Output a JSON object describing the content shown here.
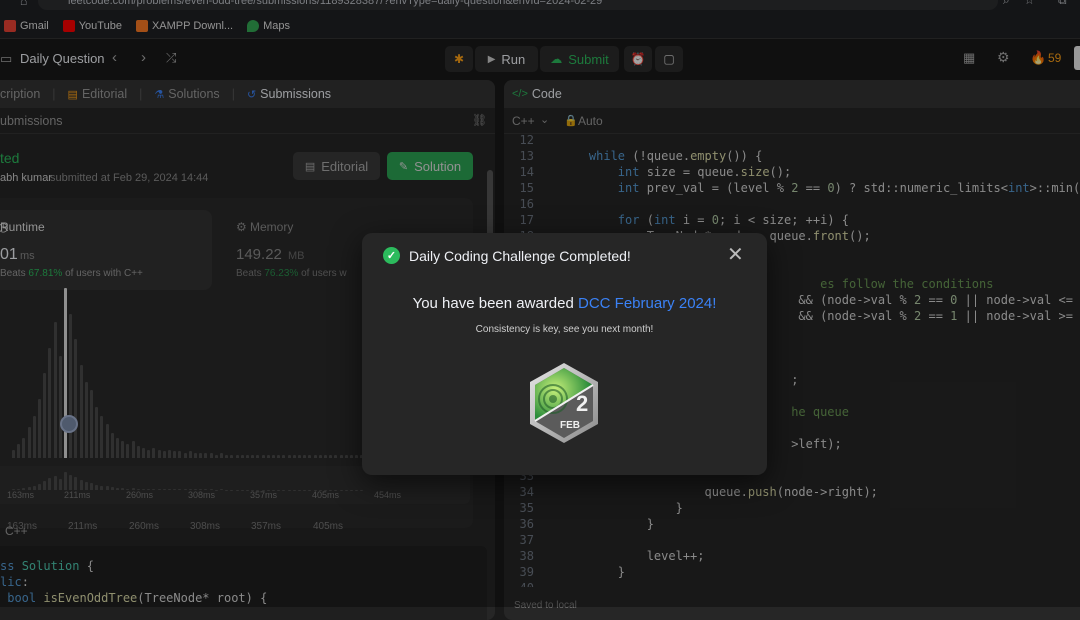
{
  "browser": {
    "url": "leetcode.com/problems/even-odd-tree/submissions/1189328387/?envType=daily-question&envId=2024-02-29",
    "bookmarks": [
      {
        "label": "Gmail",
        "icon": "gmail-icon",
        "color": "#ea4335"
      },
      {
        "label": "YouTube",
        "icon": "youtube-icon",
        "color": "#ff0000"
      },
      {
        "label": "XAMPP Downl...",
        "icon": "xampp-icon",
        "color": "#fb7a24"
      },
      {
        "label": "Maps",
        "icon": "maps-icon",
        "color": "#34a853"
      }
    ]
  },
  "topnav": {
    "title": "Daily Question",
    "run_label": "Run",
    "submit_label": "Submit",
    "streak_count": "59"
  },
  "left_panel": {
    "tabs": [
      "cription",
      "Editorial",
      "Solutions",
      "Submissions"
    ],
    "sub_header": "ubmissions",
    "status": "ted",
    "author": "abh kumar",
    "submitted_at": "submitted at Feb 29, 2024 14:44",
    "editorial_button": "Editorial",
    "solution_button": "Solution",
    "runtime_label": "Runtime",
    "runtime_value": "01",
    "runtime_unit": "ms",
    "runtime_beats_prefix": "Beats",
    "runtime_beats_pct": "67.81%",
    "runtime_beats_suffix": "of users with C++",
    "memory_label": "Memory",
    "memory_value": "149.22",
    "memory_unit": "MB",
    "memory_beats_prefix": "Beats",
    "memory_beats_pct": "76.23%",
    "memory_beats_suffix": "of users w",
    "xticks": [
      "163ms",
      "211ms",
      "260ms",
      "308ms",
      "357ms",
      "405ms"
    ],
    "mini_xticks": [
      "163ms",
      "211ms",
      "260ms",
      "308ms",
      "357ms",
      "405ms",
      "454ms"
    ],
    "lang": "C++",
    "code_lines": [
      {
        "segments": [
          {
            "t": "ss ",
            "c": "kw"
          },
          {
            "t": "Solution",
            "c": "ty"
          },
          {
            "t": " {",
            "c": ""
          }
        ]
      },
      {
        "segments": [
          {
            "t": "lic",
            "c": "kw"
          },
          {
            "t": ":",
            "c": ""
          }
        ]
      },
      {
        "segments": [
          {
            "t": " bool ",
            "c": "kw"
          },
          {
            "t": "isEvenOddTree",
            "c": "fn"
          },
          {
            "t": "(TreeNode* root) {",
            "c": ""
          }
        ]
      }
    ]
  },
  "right_panel": {
    "title": "Code",
    "lang": "C++",
    "auto_label": "Auto",
    "status_bar": "Saved to local",
    "code_lines": [
      {
        "n": "12",
        "segments": []
      },
      {
        "n": "13",
        "segments": [
          {
            "t": "    ",
            "c": ""
          },
          {
            "t": "while",
            "c": "kw"
          },
          {
            "t": " (!queue.",
            "c": ""
          },
          {
            "t": "empty",
            "c": "fn"
          },
          {
            "t": "()) {",
            "c": ""
          }
        ]
      },
      {
        "n": "14",
        "segments": [
          {
            "t": "        ",
            "c": ""
          },
          {
            "t": "int",
            "c": "kw"
          },
          {
            "t": " size = queue.",
            "c": ""
          },
          {
            "t": "size",
            "c": "fn"
          },
          {
            "t": "();",
            "c": ""
          }
        ]
      },
      {
        "n": "15",
        "segments": [
          {
            "t": "        ",
            "c": ""
          },
          {
            "t": "int",
            "c": "kw"
          },
          {
            "t": " prev_val = (level % ",
            "c": ""
          },
          {
            "t": "2",
            "c": "nm"
          },
          {
            "t": " == ",
            "c": ""
          },
          {
            "t": "0",
            "c": "nm"
          },
          {
            "t": ") ? std::numeric_limits<",
            "c": ""
          },
          {
            "t": "int",
            "c": "kw"
          },
          {
            "t": ">::min() :",
            "c": ""
          }
        ]
      },
      {
        "n": "16",
        "segments": []
      },
      {
        "n": "17",
        "segments": [
          {
            "t": "        ",
            "c": ""
          },
          {
            "t": "for",
            "c": "kw"
          },
          {
            "t": " (",
            "c": ""
          },
          {
            "t": "int",
            "c": "kw"
          },
          {
            "t": " i = ",
            "c": ""
          },
          {
            "t": "0",
            "c": "nm"
          },
          {
            "t": "; i < size; ++i) {",
            "c": ""
          }
        ]
      },
      {
        "n": "18",
        "segments": [
          {
            "t": "            TreeNode* node = queue.",
            "c": ""
          },
          {
            "t": "front",
            "c": "fn"
          },
          {
            "t": "();",
            "c": ""
          }
        ]
      },
      {
        "n": "19",
        "segments": []
      },
      {
        "n": "20",
        "segments": []
      },
      {
        "n": "21",
        "segments": [
          {
            "t": "                                    ",
            "c": ""
          },
          {
            "t": "es follow the conditions",
            "c": "cm"
          }
        ]
      },
      {
        "n": "22",
        "segments": [
          {
            "t": "                                 && (node->val % ",
            "c": ""
          },
          {
            "t": "2",
            "c": "nm"
          },
          {
            "t": " == ",
            "c": ""
          },
          {
            "t": "0",
            "c": "nm"
          },
          {
            "t": " || node->val <= prev_",
            "c": ""
          }
        ]
      },
      {
        "n": "23",
        "segments": [
          {
            "t": "                                 && (node->val % ",
            "c": ""
          },
          {
            "t": "2",
            "c": "nm"
          },
          {
            "t": " == ",
            "c": ""
          },
          {
            "t": "1",
            "c": "nm"
          },
          {
            "t": " || node->val >= prev_",
            "c": ""
          }
        ]
      },
      {
        "n": "24",
        "segments": []
      },
      {
        "n": "25",
        "segments": []
      },
      {
        "n": "26",
        "segments": []
      },
      {
        "n": "27",
        "segments": [
          {
            "t": "                                ;",
            "c": ""
          }
        ]
      },
      {
        "n": "28",
        "segments": []
      },
      {
        "n": "29",
        "segments": [
          {
            "t": "                                ",
            "c": ""
          },
          {
            "t": "he queue",
            "c": "cm"
          }
        ]
      },
      {
        "n": "30",
        "segments": []
      },
      {
        "n": "31",
        "segments": [
          {
            "t": "                                >left);",
            "c": ""
          }
        ]
      },
      {
        "n": "32",
        "segments": []
      },
      {
        "n": "33",
        "segments": []
      },
      {
        "n": "34",
        "segments": [
          {
            "t": "                    queue.",
            "c": ""
          },
          {
            "t": "push",
            "c": "fn"
          },
          {
            "t": "(node->right);",
            "c": ""
          }
        ]
      },
      {
        "n": "35",
        "segments": [
          {
            "t": "                }",
            "c": ""
          }
        ]
      },
      {
        "n": "36",
        "segments": [
          {
            "t": "            }",
            "c": ""
          }
        ]
      },
      {
        "n": "37",
        "segments": []
      },
      {
        "n": "38",
        "segments": [
          {
            "t": "            level++;",
            "c": ""
          }
        ]
      },
      {
        "n": "39",
        "segments": [
          {
            "t": "        }",
            "c": ""
          }
        ]
      },
      {
        "n": "40",
        "segments": []
      }
    ]
  },
  "modal": {
    "title": "Daily Coding Challenge Completed!",
    "awarded_prefix": "You have been awarded",
    "badge_link": "DCC February 2024!",
    "subtitle": "Consistency is key, see you next month!",
    "badge_day": "2",
    "badge_month": "FEB"
  },
  "colors": {
    "accent_green": "#2cbb5d",
    "link_blue": "#3b82f6",
    "streak_orange": "#ffa116"
  }
}
